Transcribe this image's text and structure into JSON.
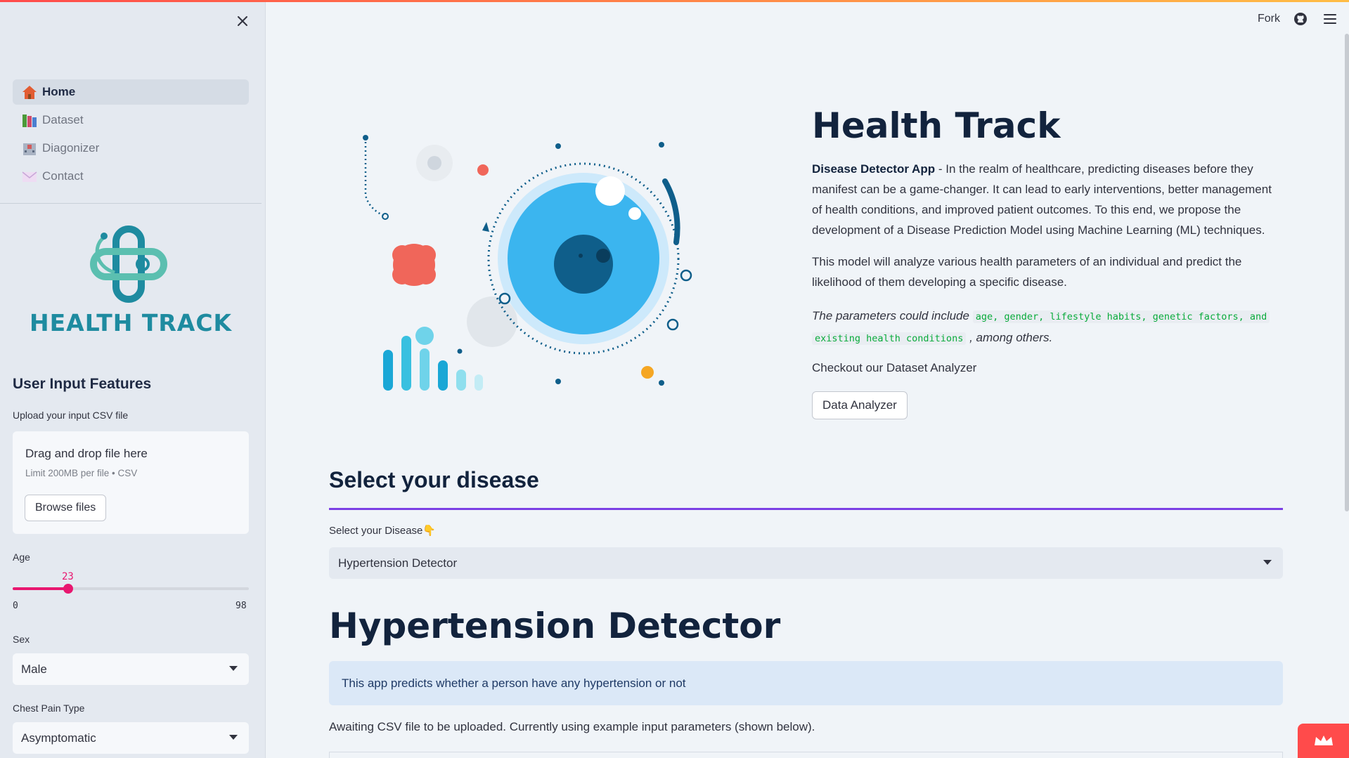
{
  "header": {
    "fork_label": "Fork"
  },
  "sidebar": {
    "nav": [
      {
        "label": "Home",
        "icon": "house-icon",
        "color": "#e25d33",
        "active": true
      },
      {
        "label": "Dataset",
        "icon": "books-icon",
        "color": "#4c9a3a",
        "active": false
      },
      {
        "label": "Diagonizer",
        "icon": "hospital-icon",
        "color": "#d35b5b",
        "active": false
      },
      {
        "label": "Contact",
        "icon": "envelope-icon",
        "color": "#c8a7d8",
        "active": false
      }
    ],
    "logo_text": "HEALTH TRACK",
    "section_title": "User Input Features",
    "upload_label": "Upload your input CSV file",
    "upload_drop": "Drag and drop file here",
    "upload_limit": "Limit 200MB per file • CSV",
    "browse_label": "Browse files",
    "age": {
      "label": "Age",
      "value": "23",
      "min": "0",
      "max": "98",
      "fraction": 0.235
    },
    "sex": {
      "label": "Sex",
      "value": "Male"
    },
    "chest_pain": {
      "label": "Chest Pain Type",
      "value": "Asymptomatic"
    }
  },
  "main": {
    "title": "Health Track",
    "intro_bold": "Disease Detector App",
    "intro_text": " - In the realm of healthcare, predicting diseases before they manifest can be a game-changer. It can lead to early interventions, better management of health conditions, and improved patient outcomes. To this end, we propose the development of a Disease Prediction Model using Machine Learning (ML) techniques.",
    "para2": "This model will analyze various health parameters of an individual and predict the likelihood of them developing a specific disease.",
    "para3_prefix": "The parameters could include",
    "para3_code1": "age, gender, lifestyle habits, genetic factors, and",
    "para3_code2": "existing health conditions",
    "para3_suffix": ", among others.",
    "checkout": "Checkout our Dataset Analyzer",
    "analyzer_button": "Data Analyzer",
    "select_heading": "Select your disease",
    "select_label": "Select your Disease👇",
    "select_value": "Hypertension Detector",
    "detector_title": "Hypertension Detector",
    "info_text": "This app predicts whether a person have any hypertension or not",
    "awaiting": "Awaiting CSV file to be uploaded. Currently using example input parameters (shown below)."
  },
  "colors": {
    "accent": "#ff4b4b",
    "slider": "#e8176f",
    "rule": "#7b3fe4",
    "info_bg": "#dbe8f7",
    "brand": "#1e8ba0"
  }
}
